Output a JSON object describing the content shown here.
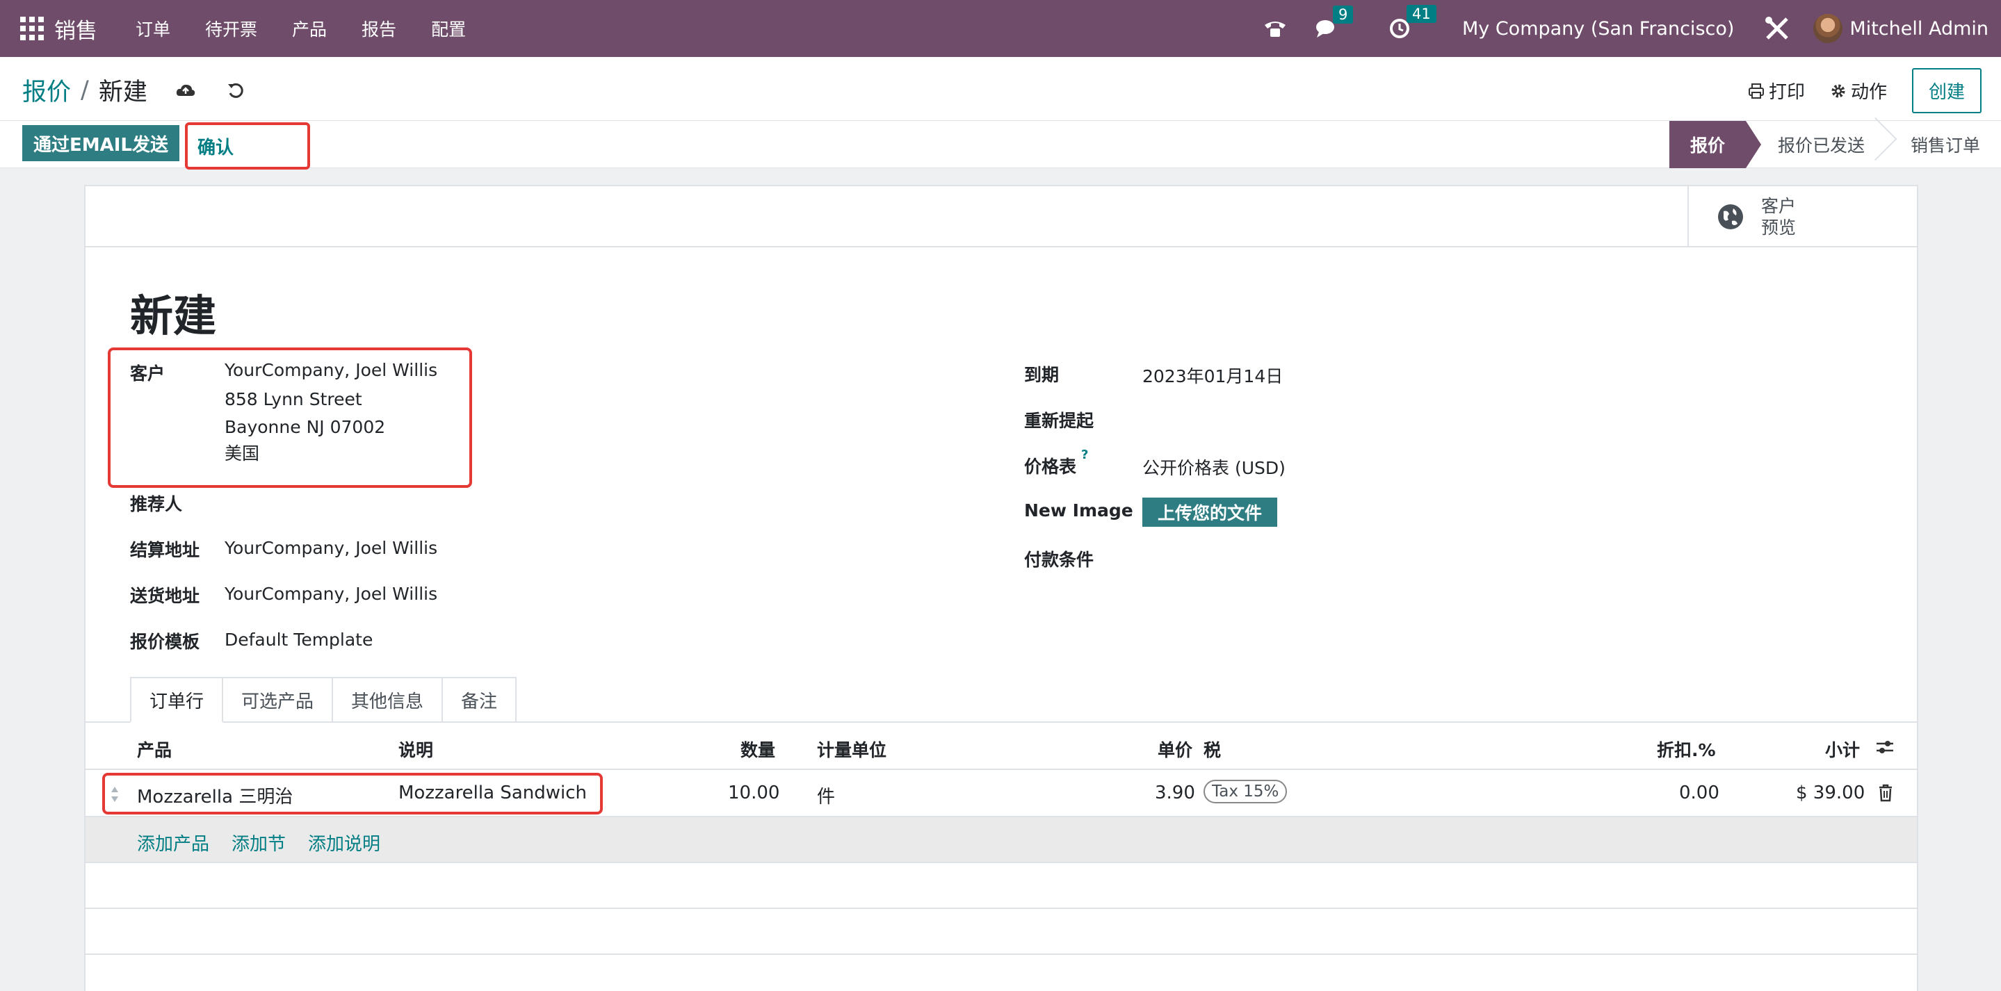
{
  "topbar": {
    "app_name": "销售",
    "menu": [
      "订单",
      "待开票",
      "产品",
      "报告",
      "配置"
    ],
    "messages_count": "9",
    "activities_count": "41",
    "company": "My Company (San Francisco)",
    "user": "Mitchell Admin"
  },
  "control": {
    "breadcrumb_parent": "报价",
    "breadcrumb_sep": "/",
    "breadcrumb_current": "新建",
    "print_label": "打印",
    "action_label": "动作",
    "create_label": "创建"
  },
  "statusbar": {
    "send_email_label": "通过EMAIL发送",
    "confirm_label": "确认",
    "stages": [
      "报价",
      "报价已发送",
      "销售订单"
    ],
    "active_stage": "报价"
  },
  "sheet": {
    "preview_label_1": "客户",
    "preview_label_2": "预览",
    "title": "新建",
    "left_fields": {
      "customer_label": "客户",
      "customer_lines": [
        "YourCompany, Joel Willis",
        "858 Lynn Street",
        "Bayonne NJ 07002",
        "美国"
      ],
      "referrer_label": "推荐人",
      "invoice_address_label": "结算地址",
      "invoice_address_value": "YourCompany, Joel Willis",
      "delivery_address_label": "送货地址",
      "delivery_address_value": "YourCompany, Joel Willis",
      "template_label": "报价模板",
      "template_value": "Default Template"
    },
    "right_fields": {
      "expiration_label": "到期",
      "expiration_value": "2023年01月14日",
      "reminder_label": "重新提起",
      "pricelist_label": "价格表",
      "pricelist_help": "?",
      "pricelist_value": "公开价格表 (USD)",
      "new_image_label": "New Image",
      "upload_label": "上传您的文件",
      "payment_terms_label": "付款条件"
    },
    "tabs": [
      "订单行",
      "可选产品",
      "其他信息",
      "备注"
    ],
    "table": {
      "headers": {
        "product": "产品",
        "description": "说明",
        "quantity": "数量",
        "uom": "计量单位",
        "unit_price": "单价",
        "taxes": "税",
        "discount": "折扣.%",
        "subtotal": "小计"
      },
      "rows": [
        {
          "product": "Mozzarella 三明治",
          "description": "Mozzarella Sandwich",
          "quantity": "10.00",
          "uom": "件",
          "unit_price": "3.90",
          "tax": "Tax 15%",
          "discount": "0.00",
          "subtotal": "$ 39.00"
        }
      ],
      "add_product": "添加产品",
      "add_section": "添加节",
      "add_note": "添加说明"
    }
  },
  "colors": {
    "nav": "#6f4c6a",
    "primary": "#017e84",
    "button_fill": "#2e7d82",
    "highlight": "#e53935"
  }
}
